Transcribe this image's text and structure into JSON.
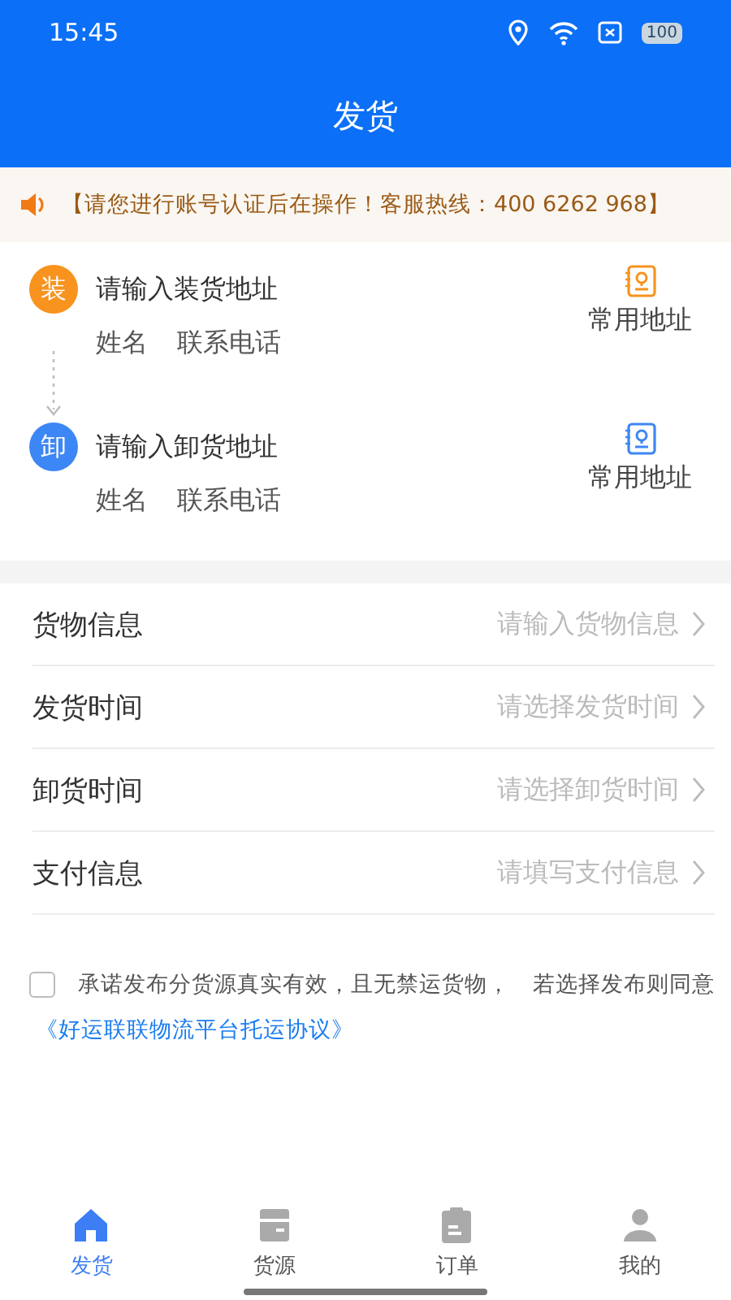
{
  "status_bar": {
    "time": "15:45",
    "battery": "100"
  },
  "header": {
    "title": "发货"
  },
  "notice": {
    "text": "【请您进行账号认证后在操作！客服热线：400 6262 968】"
  },
  "addresses": [
    {
      "badge": "装",
      "color": "#f7931e",
      "placeholder": "请输入装货地址",
      "name": "姓名",
      "phone": "联系电话",
      "shortcut": "常用地址"
    },
    {
      "badge": "卸",
      "color": "#3d86f5",
      "placeholder": "请输入卸货地址",
      "name": "姓名",
      "phone": "联系电话",
      "shortcut": "常用地址"
    }
  ],
  "form": [
    {
      "label": "货物信息",
      "placeholder": "请输入货物信息"
    },
    {
      "label": "发货时间",
      "placeholder": "请选择发货时间"
    },
    {
      "label": "卸货时间",
      "placeholder": "请选择卸货时间"
    },
    {
      "label": "支付信息",
      "placeholder": "请填写支付信息"
    }
  ],
  "agreement": {
    "checked": false,
    "text": "承诺发布分货源真实有效，且无禁运货物，　若选择发布则同意",
    "link": "《好运联联物流平台托运协议》"
  },
  "tabs": [
    {
      "kind": "home",
      "label": "发货",
      "selected": true
    },
    {
      "kind": "box",
      "label": "货源",
      "selected": false
    },
    {
      "kind": "clipboard",
      "label": "订单",
      "selected": false
    },
    {
      "kind": "person",
      "label": "我的",
      "selected": false
    }
  ]
}
